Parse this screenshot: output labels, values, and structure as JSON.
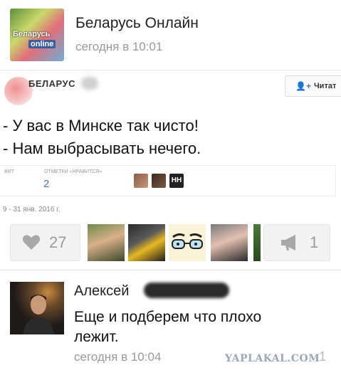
{
  "post": {
    "group_name": "Беларусь Онлайн",
    "time": "сегодня в 10:01",
    "avatar_text_1": "Беларусь",
    "avatar_text_2": "online"
  },
  "embedded": {
    "source_name": "БЕЛАРУС",
    "read_button": "Читат",
    "line1": "- У вас в Минске так чисто!",
    "line2": "- Нам выбрасывать нечего.",
    "stat_label_1": "ВИТ",
    "stat_label_2": "ОТМЕТКИ «НРАВИТСЯ»",
    "likes_value": "2",
    "face_3_label": "НН",
    "date_range": "9 - 31 янв. 2016 г."
  },
  "actions": {
    "like_count": "27",
    "share_count": "1"
  },
  "comment": {
    "author": "Алексей",
    "text": "Еще и подберем что плохо лежит.",
    "time": "сегодня в 10:04",
    "like_count": "1"
  },
  "watermark": "YAPLAKAL.COM",
  "colors": {
    "link_blue": "#4a76a8",
    "muted_text": "#999999",
    "button_bg": "#f2f2f2"
  }
}
